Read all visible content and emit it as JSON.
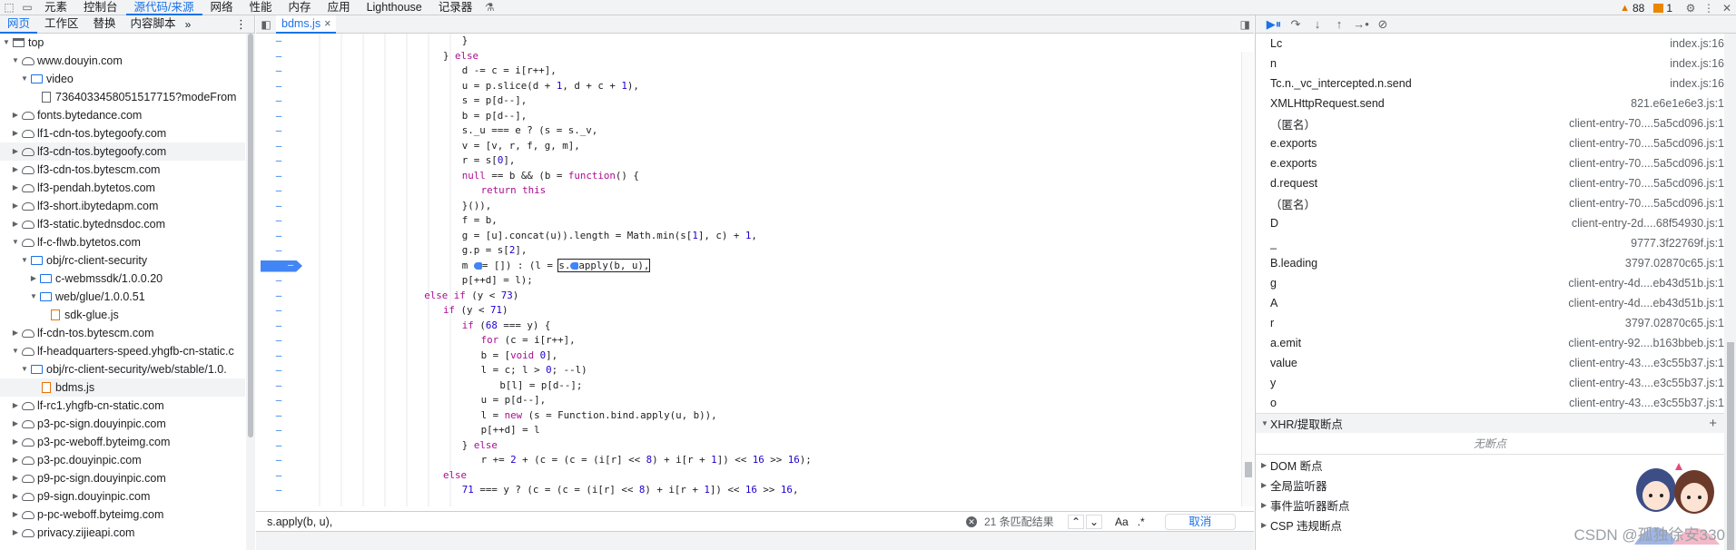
{
  "topbar": {
    "tabs": [
      "元素",
      "控制台",
      "源代码/来源",
      "网络",
      "性能",
      "内存",
      "应用",
      "Lighthouse",
      "记录器"
    ],
    "active_tab": "源代码/来源",
    "warnings_count": "88",
    "errors_count": "1"
  },
  "navigator": {
    "tabs": [
      "网页",
      "工作区",
      "替换",
      "内容脚本"
    ],
    "active_tab": "网页",
    "more": "»",
    "tree": [
      {
        "label": "top",
        "depth": 0,
        "icon": "frame",
        "open": true
      },
      {
        "label": "www.douyin.com",
        "depth": 1,
        "icon": "cloud",
        "open": true
      },
      {
        "label": "video",
        "depth": 2,
        "icon": "folder",
        "open": true
      },
      {
        "label": "7364033458051517715?modeFrom",
        "depth": 3,
        "icon": "doc"
      },
      {
        "label": "fonts.bytedance.com",
        "depth": 1,
        "icon": "cloud",
        "open": false
      },
      {
        "label": "lf1-cdn-tos.bytegoofy.com",
        "depth": 1,
        "icon": "cloud",
        "open": false
      },
      {
        "label": "lf3-cdn-tos.bytegoofy.com",
        "depth": 1,
        "icon": "cloud",
        "open": false,
        "selected": true
      },
      {
        "label": "lf3-cdn-tos.bytescm.com",
        "depth": 1,
        "icon": "cloud",
        "open": false
      },
      {
        "label": "lf3-pendah.bytetos.com",
        "depth": 1,
        "icon": "cloud",
        "open": false
      },
      {
        "label": "lf3-short.ibytedapm.com",
        "depth": 1,
        "icon": "cloud",
        "open": false
      },
      {
        "label": "lf3-static.bytednsdoc.com",
        "depth": 1,
        "icon": "cloud",
        "open": false
      },
      {
        "label": "lf-c-flwb.bytetos.com",
        "depth": 1,
        "icon": "cloud",
        "open": true
      },
      {
        "label": "obj/rc-client-security",
        "depth": 2,
        "icon": "folder",
        "open": true
      },
      {
        "label": "c-webmssdk/1.0.0.20",
        "depth": 3,
        "icon": "folder",
        "open": false
      },
      {
        "label": "web/glue/1.0.0.51",
        "depth": 3,
        "icon": "folder",
        "open": true
      },
      {
        "label": "sdk-glue.js",
        "depth": 4,
        "icon": "js"
      },
      {
        "label": "lf-cdn-tos.bytescm.com",
        "depth": 1,
        "icon": "cloud",
        "open": false
      },
      {
        "label": "lf-headquarters-speed.yhgfb-cn-static.c",
        "depth": 1,
        "icon": "cloud",
        "open": true
      },
      {
        "label": "obj/rc-client-security/web/stable/1.0.",
        "depth": 2,
        "icon": "folder",
        "open": true
      },
      {
        "label": "bdms.js",
        "depth": 3,
        "icon": "js",
        "selected": true
      },
      {
        "label": "lf-rc1.yhgfb-cn-static.com",
        "depth": 1,
        "icon": "cloud",
        "open": false
      },
      {
        "label": "p3-pc-sign.douyinpic.com",
        "depth": 1,
        "icon": "cloud",
        "open": false
      },
      {
        "label": "p3-pc-weboff.byteimg.com",
        "depth": 1,
        "icon": "cloud",
        "open": false
      },
      {
        "label": "p3-pc.douyinpic.com",
        "depth": 1,
        "icon": "cloud",
        "open": false
      },
      {
        "label": "p9-pc-sign.douyinpic.com",
        "depth": 1,
        "icon": "cloud",
        "open": false
      },
      {
        "label": "p9-sign.douyinpic.com",
        "depth": 1,
        "icon": "cloud",
        "open": false
      },
      {
        "label": "p-pc-weboff.byteimg.com",
        "depth": 1,
        "icon": "cloud",
        "open": false
      },
      {
        "label": "privacy.zijieapi.com",
        "depth": 1,
        "icon": "cloud",
        "open": false
      }
    ]
  },
  "editor": {
    "file_tab": "bdms.js",
    "close_glyph": "×",
    "lines": [
      {
        "indent": 34,
        "html": "}"
      },
      {
        "indent": 30,
        "html": "} <span class='kw'>else</span>"
      },
      {
        "indent": 34,
        "html": "d -= c = i[r++],"
      },
      {
        "indent": 34,
        "html": "u = p.slice(d + <span class='num'>1</span>, d + c + <span class='num'>1</span>),"
      },
      {
        "indent": 34,
        "html": "s = p[d--],"
      },
      {
        "indent": 34,
        "html": "b = p[d--],"
      },
      {
        "indent": 34,
        "html": "s._u === e ? (s = s._v,"
      },
      {
        "indent": 34,
        "html": "v = [v, r, f, g, m],"
      },
      {
        "indent": 34,
        "html": "r = s[<span class='num'>0</span>],"
      },
      {
        "indent": 34,
        "html": "<span class='kw'>null</span> == b &amp;&amp; (b = <span class='kw'>function</span>() {"
      },
      {
        "indent": 38,
        "html": "<span class='kw'>return this</span>"
      },
      {
        "indent": 34,
        "html": "}()),"
      },
      {
        "indent": 34,
        "html": "f = b,"
      },
      {
        "indent": 34,
        "html": "g = [u].concat(u)).length = Math.min(s[<span class='num'>1</span>], c) + <span class='num'>1</span>,"
      },
      {
        "indent": 34,
        "html": "g.p = s[<span class='num'>2</span>],"
      },
      {
        "indent": 34,
        "html": "m <span class='execdot'></span>= []) : (l = <span class='hl'>s.<span class='execdot'></span>apply(b, u),</span>"
      },
      {
        "indent": 34,
        "html": "p[++d] = l);"
      },
      {
        "indent": 26,
        "html": "<span class='kw'>else if</span> (y &lt; <span class='num'>73</span>)"
      },
      {
        "indent": 30,
        "html": "<span class='kw'>if</span> (y &lt; <span class='num'>71</span>)"
      },
      {
        "indent": 34,
        "html": "<span class='kw'>if</span> (<span class='num'>68</span> === y) {"
      },
      {
        "indent": 38,
        "html": "<span class='kw'>for</span> (c = i[r++],"
      },
      {
        "indent": 38,
        "html": "b = [<span class='kw'>void</span> <span class='num'>0</span>],"
      },
      {
        "indent": 38,
        "html": "l = c; l &gt; <span class='num'>0</span>; --l)"
      },
      {
        "indent": 42,
        "html": "b[l] = p[d--];"
      },
      {
        "indent": 38,
        "html": "u = p[d--],"
      },
      {
        "indent": 38,
        "html": "l = <span class='kw'>new</span> (s = Function.bind.apply(u, b)),"
      },
      {
        "indent": 38,
        "html": "p[++d] = l"
      },
      {
        "indent": 34,
        "html": "} <span class='kw'>else</span>"
      },
      {
        "indent": 38,
        "html": "r += <span class='num'>2</span> + (c = (c = (i[r] &lt;&lt; <span class='num'>8</span>) + i[r + <span class='num'>1</span>]) &lt;&lt; <span class='num'>16</span> &gt;&gt; <span class='num'>16</span>);"
      },
      {
        "indent": 30,
        "html": "<span class='kw'>else</span>"
      },
      {
        "indent": 34,
        "html": "<span class='num'>71</span> === y ? (c = (c = (i[r] &lt;&lt; <span class='num'>8</span>) + i[r + <span class='num'>1</span>]) &lt;&lt; <span class='num'>16</span> &gt;&gt; <span class='num'>16</span>,"
      }
    ],
    "breakpoint_line": 15
  },
  "search": {
    "query": "s.apply(b, u),",
    "match_count": "21 条匹配结果",
    "case_label": "Aa",
    "regex_label": ".*",
    "cancel_label": "取消"
  },
  "callstack": [
    {
      "name": "Lc",
      "loc": "index.js:16"
    },
    {
      "name": "n",
      "loc": "index.js:16"
    },
    {
      "name": "Tc.n._vc_intercepted.n.send",
      "loc": "index.js:16"
    },
    {
      "name": "XMLHttpRequest.send",
      "loc": "821.e6e1e6e3.js:1"
    },
    {
      "name": "（匿名）",
      "loc": "client-entry-70....5a5cd096.js:1"
    },
    {
      "name": "e.exports",
      "loc": "client-entry-70....5a5cd096.js:1"
    },
    {
      "name": "e.exports",
      "loc": "client-entry-70....5a5cd096.js:1"
    },
    {
      "name": "d.request",
      "loc": "client-entry-70....5a5cd096.js:1"
    },
    {
      "name": "（匿名）",
      "loc": "client-entry-70....5a5cd096.js:1"
    },
    {
      "name": "D",
      "loc": "client-entry-2d....68f54930.js:1"
    },
    {
      "name": "_",
      "loc": "9777.3f22769f.js:1"
    },
    {
      "name": "B.leading",
      "loc": "3797.02870c65.js:1"
    },
    {
      "name": "g",
      "loc": "client-entry-4d....eb43d51b.js:1"
    },
    {
      "name": "A",
      "loc": "client-entry-4d....eb43d51b.js:1"
    },
    {
      "name": "r",
      "loc": "3797.02870c65.js:1"
    },
    {
      "name": "a.emit",
      "loc": "client-entry-92....b163bbeb.js:1"
    },
    {
      "name": "value",
      "loc": "client-entry-43....e3c55b37.js:1"
    },
    {
      "name": "y",
      "loc": "client-entry-43....e3c55b37.js:1"
    },
    {
      "name": "o",
      "loc": "client-entry-43....e3c55b37.js:1"
    }
  ],
  "sections": {
    "xhr": "XHR/提取断点",
    "no_breakpoints": "无断点",
    "dom": "DOM 断点",
    "global": "全局监听器",
    "event": "事件监听器断点",
    "csp": "CSP 违规断点"
  },
  "watermark": "CSDN @孤独徐安330"
}
